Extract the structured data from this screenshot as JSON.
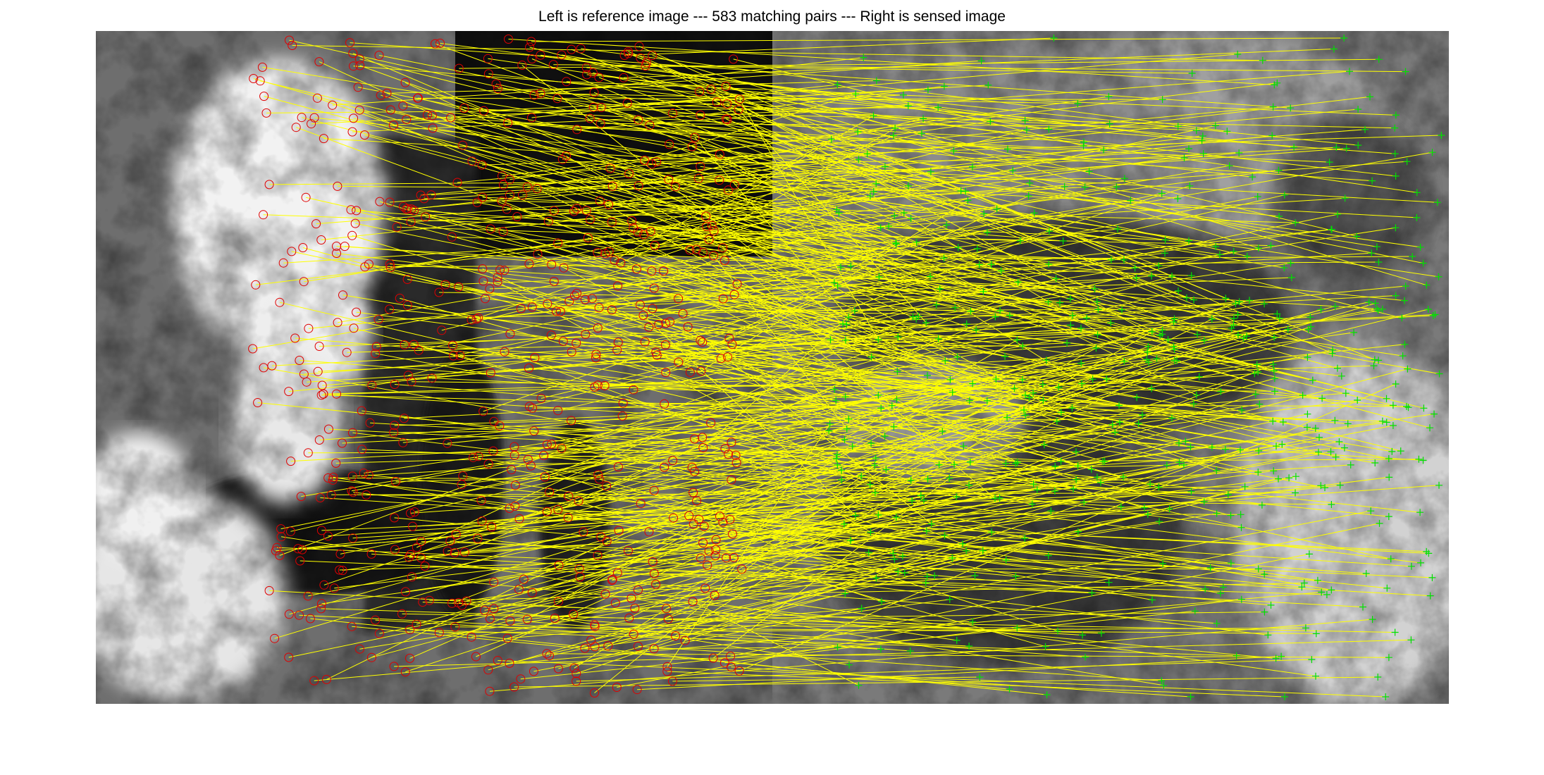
{
  "title": "Left is reference image --- 583 matching pairs --- Right is sensed image",
  "figure": {
    "left_panel_name": "reference image",
    "right_panel_name": "sensed image",
    "pair_count": 583,
    "match_line_color": "#ffff00",
    "reference_marker": {
      "shape": "circle",
      "color": "#e00000"
    },
    "sensed_marker": {
      "shape": "plus",
      "color": "#00e000"
    }
  }
}
